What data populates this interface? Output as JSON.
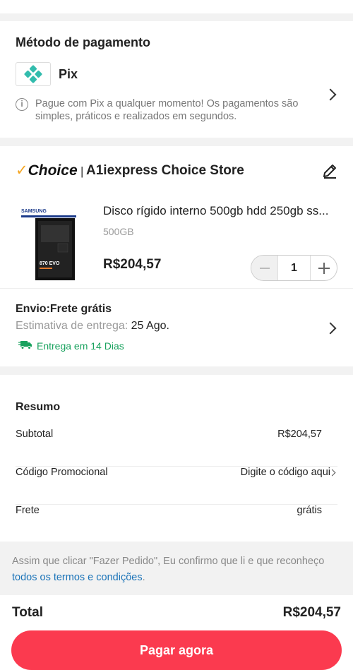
{
  "colors": {
    "accent": "#fb3a4f",
    "pix": "#32bcad",
    "success": "#19a25e",
    "link": "#1a73b8",
    "choice_check": "#f5a623"
  },
  "payment": {
    "title": "Método de pagamento",
    "method_name": "Pix",
    "method_icon": "pix-icon",
    "info": "Pague com Pix a qualquer momento! Os pagamentos são simples, práticos e realizados em segundos."
  },
  "store": {
    "badge": "Choice",
    "separator": "|",
    "name": "A1iexpress Choice Store",
    "product": {
      "title": "Disco rígido interno 500gb hdd 250gb ss...",
      "variant": "500GB",
      "price": "R$204,57",
      "quantity": "1",
      "image_brand": "SAMSUNG",
      "image_model": "870 EVO"
    },
    "shipping": {
      "title": "Envio:Frete grátis",
      "estimate_label": "Estimativa de entrega:",
      "estimate_date": "25 Ago.",
      "fast_label": "Entrega em 14 Dias"
    }
  },
  "summary": {
    "title": "Resumo",
    "subtotal_label": "Subtotal",
    "subtotal_value": "R$204,57",
    "promo_label": "Código Promocional",
    "promo_value": "Digite o código aqui",
    "shipping_label": "Frete",
    "shipping_value": "grátis"
  },
  "terms": {
    "text": "Assim que clicar \"Fazer Pedido\", Eu confirmo que li e que reconheço ",
    "link": "todos os termos e condições",
    "end": "."
  },
  "footer": {
    "total_label": "Total",
    "total_value": "R$204,57",
    "pay_button": "Pagar agora"
  }
}
